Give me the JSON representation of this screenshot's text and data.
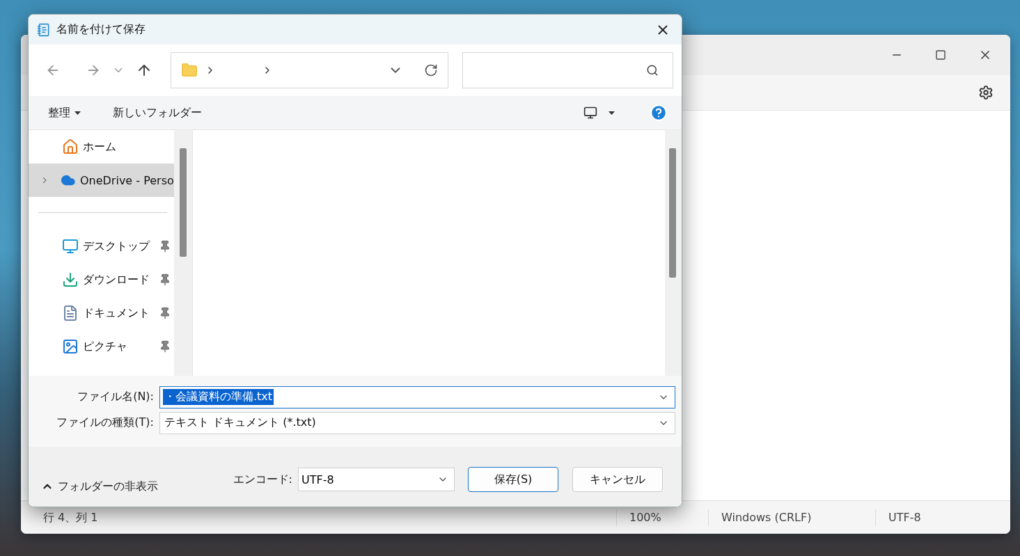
{
  "notepad": {
    "status_bar": [
      "行 4、列 1",
      "100%",
      "Windows (CRLF)",
      "UTF-8"
    ]
  },
  "dialog": {
    "title": "名前を付けて保存",
    "command_bar": {
      "organize": "整理",
      "new_folder": "新しいフォルダー"
    },
    "sidebar": {
      "items": [
        {
          "label": "ホーム",
          "kind": "home",
          "selected": false,
          "pinned": false,
          "expandable": false
        },
        {
          "label": "OneDrive - Perso",
          "kind": "cloud",
          "selected": true,
          "pinned": false,
          "expandable": true
        },
        {
          "kind": "divider"
        },
        {
          "label": "デスクトップ",
          "kind": "desktop",
          "selected": false,
          "pinned": true,
          "expandable": false
        },
        {
          "label": "ダウンロード",
          "kind": "download",
          "selected": false,
          "pinned": true,
          "expandable": false
        },
        {
          "label": "ドキュメント",
          "kind": "documents",
          "selected": false,
          "pinned": true,
          "expandable": false
        },
        {
          "label": "ピクチャ",
          "kind": "pictures",
          "selected": false,
          "pinned": true,
          "expandable": false
        }
      ]
    },
    "fields": [
      {
        "label": "ファイル名(N):",
        "value": "・会議資料の準備.txt",
        "focused": true,
        "text_selected": true
      },
      {
        "label": "ファイルの種類(T):",
        "value": "テキスト ドキュメント (*.txt)",
        "focused": false,
        "text_selected": false
      }
    ],
    "folder_toggle": "フォルダーの非表示",
    "encoding": {
      "label": "エンコード:",
      "value": "UTF-8"
    },
    "buttons": [
      {
        "label": "保存(S)",
        "default": true
      },
      {
        "label": "キャンセル",
        "default": false
      }
    ]
  }
}
